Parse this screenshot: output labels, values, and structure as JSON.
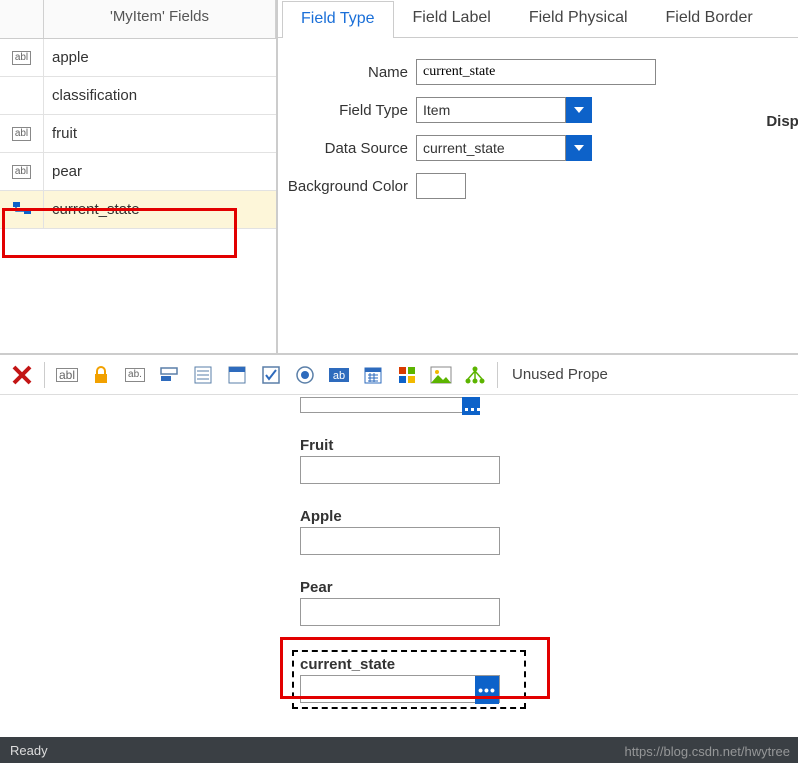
{
  "fields_panel": {
    "title": "'MyItem' Fields",
    "items": [
      {
        "icon": "abl",
        "name": "apple"
      },
      {
        "icon": "none",
        "name": "classification"
      },
      {
        "icon": "abl",
        "name": "fruit"
      },
      {
        "icon": "abl",
        "name": "pear"
      },
      {
        "icon": "item",
        "name": "current_state",
        "selected": true
      }
    ]
  },
  "tabs": [
    {
      "label": "Field Type",
      "active": true
    },
    {
      "label": "Field Label"
    },
    {
      "label": "Field Physical"
    },
    {
      "label": "Field Border"
    }
  ],
  "form": {
    "name_label": "Name",
    "name_value": "current_state",
    "type_label": "Field Type",
    "type_value": "Item",
    "ds_label": "Data Source",
    "ds_value": "current_state",
    "bg_label": "Background Color",
    "extra_label": "Displ"
  },
  "toolbar": {
    "unused_label": "Unused Prope"
  },
  "preview": {
    "fields": [
      {
        "label": "Fruit"
      },
      {
        "label": "Apple"
      },
      {
        "label": "Pear"
      },
      {
        "label": "current_state",
        "selected": true,
        "has_btn": true
      }
    ]
  },
  "status": {
    "text": "Ready"
  },
  "watermark": "https://blog.csdn.net/hwytree"
}
